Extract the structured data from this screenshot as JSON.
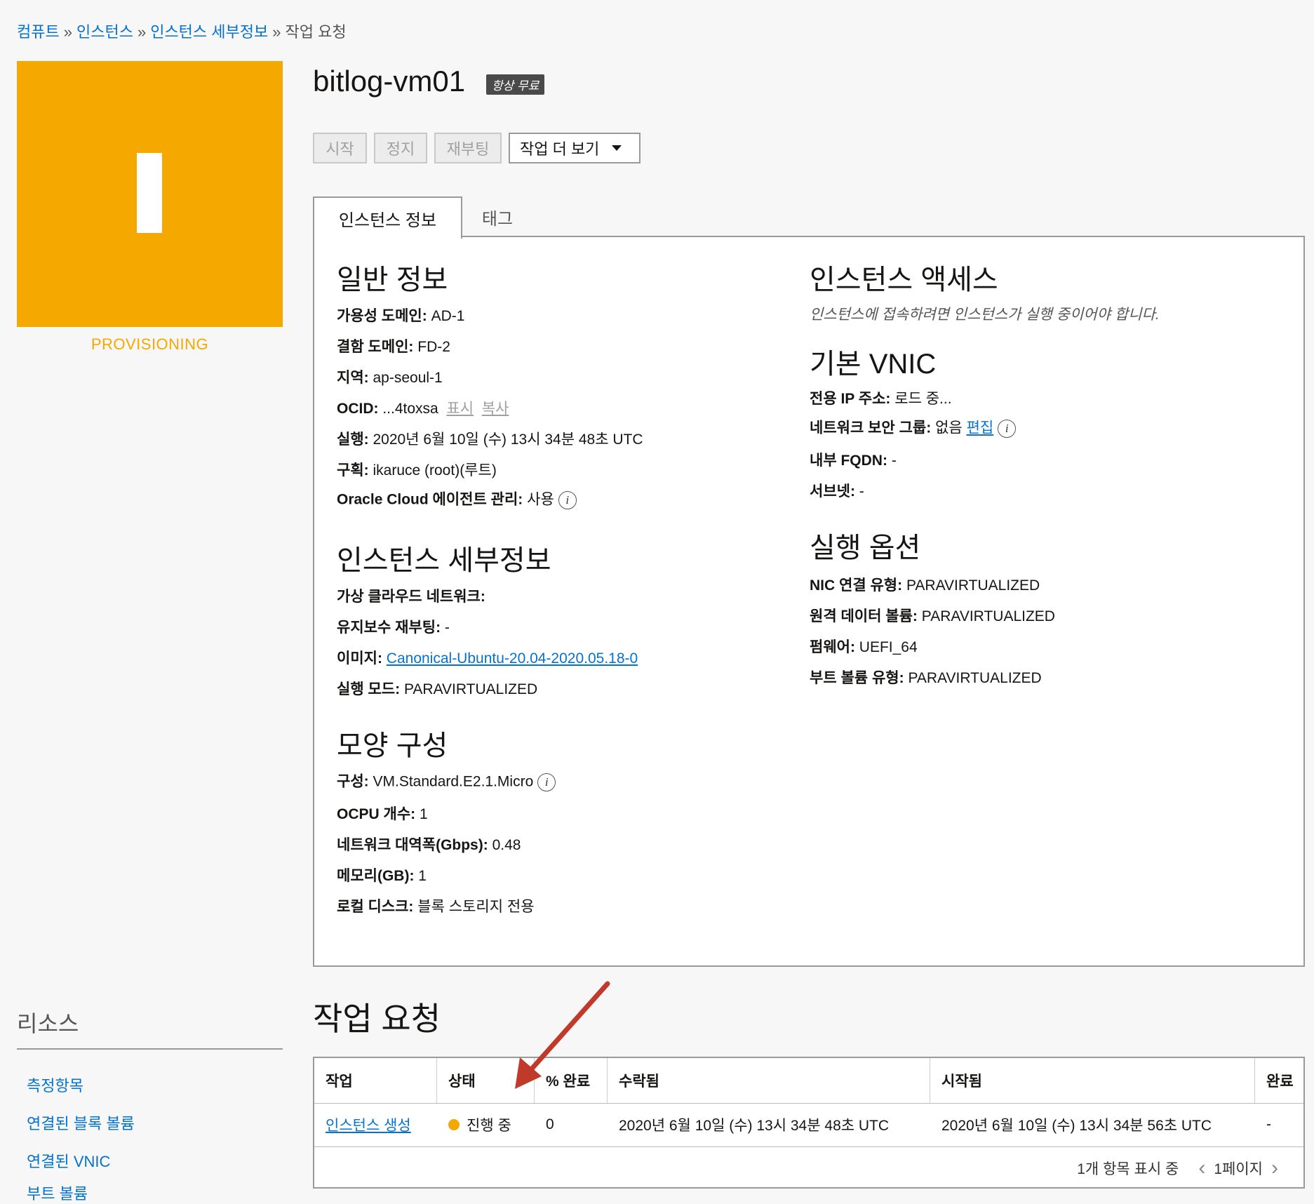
{
  "breadcrumb": {
    "items": [
      "컴퓨트",
      "인스턴스",
      "인스턴스 세부정보"
    ],
    "separator": "»",
    "current": "작업 요청"
  },
  "instance": {
    "name": "bitlog-vm01",
    "badge": "항상 무료",
    "state": "PROVISIONING",
    "state_color": "#f5a800"
  },
  "actions": {
    "start": "시작",
    "stop": "정지",
    "reboot": "재부팅",
    "more": "작업 더 보기"
  },
  "tabs": {
    "info": "인스턴스 정보",
    "tags": "태그"
  },
  "general": {
    "heading": "일반 정보",
    "availability_domain": {
      "label": "가용성 도메인:",
      "value": "AD-1"
    },
    "fault_domain": {
      "label": "결함 도메인:",
      "value": "FD-2"
    },
    "region": {
      "label": "지역:",
      "value": "ap-seoul-1"
    },
    "ocid": {
      "label": "OCID:",
      "value": "...4toxsa",
      "show": "표시",
      "copy": "복사"
    },
    "launched": {
      "label": "실행:",
      "value": "2020년 6월 10일 (수) 13시 34분 48초 UTC"
    },
    "compartment": {
      "label": "구획:",
      "value": "ikaruce (root)(루트)"
    },
    "agent": {
      "label": "Oracle Cloud 에이전트 관리:",
      "value": "사용"
    }
  },
  "details": {
    "heading": "인스턴스 세부정보",
    "vcn": {
      "label": "가상 클라우드 네트워크:",
      "value": ""
    },
    "maintenance": {
      "label": "유지보수 재부팅:",
      "value": "-"
    },
    "image": {
      "label": "이미지:",
      "value": "Canonical-Ubuntu-20.04-2020.05.18-0"
    },
    "launch_mode": {
      "label": "실행 모드:",
      "value": "PARAVIRTUALIZED"
    }
  },
  "shape": {
    "heading": "모양 구성",
    "shape": {
      "label": "구성:",
      "value": "VM.Standard.E2.1.Micro"
    },
    "ocpu": {
      "label": "OCPU 개수:",
      "value": "1"
    },
    "bandwidth": {
      "label": "네트워크 대역폭(Gbps):",
      "value": "0.48"
    },
    "memory": {
      "label": "메모리(GB):",
      "value": "1"
    },
    "local_disk": {
      "label": "로컬 디스크:",
      "value": "블록 스토리지 전용"
    }
  },
  "access": {
    "heading": "인스턴스 액세스",
    "note": "인스턴스에 접속하려면 인스턴스가 실행 중이어야 합니다."
  },
  "vnic": {
    "heading": "기본 VNIC",
    "private_ip": {
      "label": "전용 IP 주소:",
      "value": "로드 중..."
    },
    "nsg": {
      "label": "네트워크 보안 그룹:",
      "value": "없음",
      "edit": "편집"
    },
    "fqdn": {
      "label": "내부 FQDN:",
      "value": "-"
    },
    "subnet": {
      "label": "서브넷:",
      "value": "-"
    }
  },
  "launch_options": {
    "heading": "실행 옵션",
    "nic": {
      "label": "NIC 연결 유형:",
      "value": "PARAVIRTUALIZED"
    },
    "remote_volume": {
      "label": "원격 데이터 볼륨:",
      "value": "PARAVIRTUALIZED"
    },
    "firmware": {
      "label": "펌웨어:",
      "value": "UEFI_64"
    },
    "boot_volume": {
      "label": "부트 볼륨 유형:",
      "value": "PARAVIRTUALIZED"
    }
  },
  "resources": {
    "title": "리소스",
    "items": [
      "측정항목",
      "연결된 블록 볼륨",
      "연결된 VNIC",
      "부트 볼륨"
    ]
  },
  "work_requests": {
    "title": "작업 요청",
    "columns": [
      "작업",
      "상태",
      "% 완료",
      "수락됨",
      "시작됨",
      "완료"
    ],
    "rows": [
      {
        "operation": "인스턴스 생성",
        "status": "진행 중",
        "percent": "0",
        "accepted": "2020년 6월 10일 (수) 13시 34분 48초 UTC",
        "started": "2020년 6월 10일 (수) 13시 34분 56초 UTC",
        "finished": "-"
      }
    ],
    "pager_text": "1개 항목 표시 중",
    "page": "1페이지"
  }
}
